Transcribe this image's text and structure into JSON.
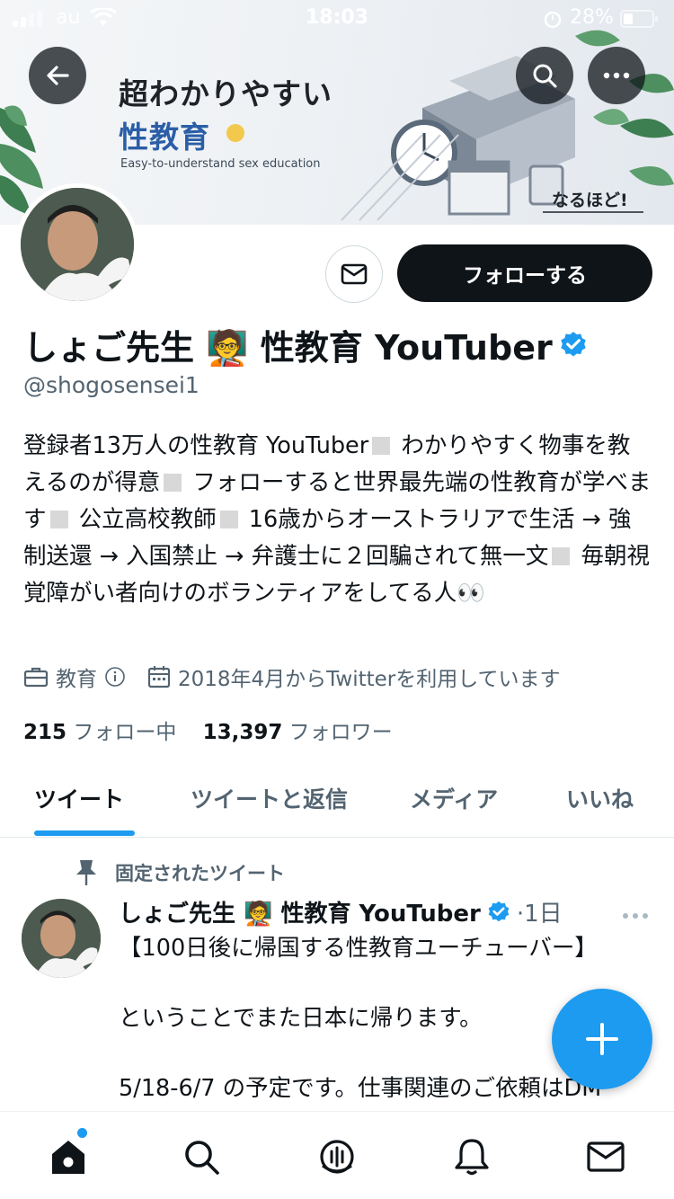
{
  "status_bar": {
    "carrier": "au",
    "time": "18:03",
    "battery": "28%"
  },
  "banner": {
    "title": "超わかりやすい",
    "subtitle": "性教育",
    "english": "Easy-to-understand sex education",
    "bubble": "なるほど!"
  },
  "profile": {
    "follow_label": "フォローする",
    "name": "しょご先生 🧑‍🏫 性教育 YouTuber",
    "handle": "@shogosensei1",
    "bio_segments": [
      "登録者13万人の性教育 YouTuber",
      "わかりやすく物事を教えるのが得意",
      "フォローすると世界最先端の性教育が学べます",
      "公立高校教師",
      "16歳からオーストラリアで生活 → 強制送還 → 入国禁止 → 弁護士に２回騙されて無一文",
      "毎朝視覚障がい者向けのボランティアをしてる人👀"
    ],
    "category": "教育",
    "joined": "2018年4月からTwitterを利用しています",
    "following_count": "215",
    "following_label": "フォロー中",
    "followers_count": "13,397",
    "followers_label": "フォロワー"
  },
  "tabs": [
    "ツイート",
    "ツイートと返信",
    "メディア",
    "いいね"
  ],
  "pinned_tweet": {
    "pinned_label": "固定されたツイート",
    "author": "しょご先生 🧑‍🏫 性教育 YouTuber",
    "time": "·1日",
    "text": "【100日後に帰国する性教育ユーチューバー】\n\nということでまた日本に帰ります。\n\n5/18-6/7 の予定です。仕事関連のご依頼はDM\n\nよろしくお願いします😊"
  },
  "icons": {
    "back": "arrow-left-icon",
    "search": "search-icon",
    "more": "more-icon",
    "message": "envelope-icon",
    "verified": "verified-badge-icon",
    "pin": "pin-icon",
    "compose": "plus-icon",
    "nav": [
      "home-icon",
      "search-icon",
      "spaces-icon",
      "bell-icon",
      "envelope-icon"
    ]
  },
  "colors": {
    "accent": "#1d9bf0",
    "text": "#0f1419",
    "secondary": "#536471"
  }
}
